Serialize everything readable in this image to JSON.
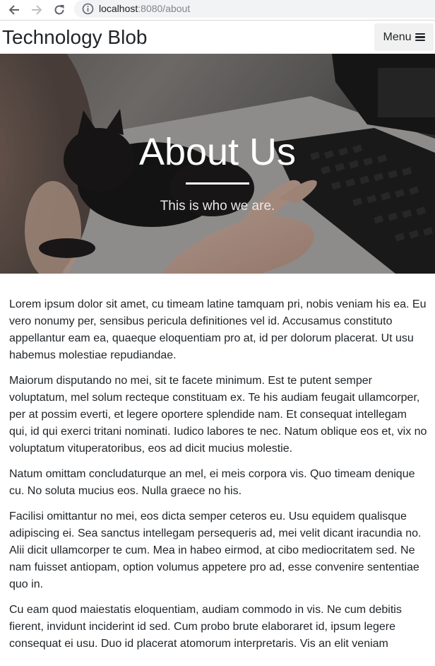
{
  "browser": {
    "url_host": "localhost",
    "url_rest": ":8080/about",
    "icons": [
      "back-arrow-icon",
      "forward-arrow-icon",
      "reload-icon",
      "info-icon"
    ]
  },
  "navbar": {
    "brand": "Technology Blob",
    "menu_label": "Menu",
    "menu_icon": "bars-icon"
  },
  "header": {
    "title": "About Us",
    "subtitle": "This is who we are.",
    "background": "photo of a black cat on a keyboard with a hand"
  },
  "content": {
    "paragraphs": [
      "Lorem ipsum dolor sit amet, cu timeam latine tamquam pri, nobis veniam his ea. Eu vero nonumy per, sensibus pericula definitiones vel id. Accusamus constituto appellantur eam ea, quaeque eloquentiam pro at, id per dolorum placerat. Ut usu habemus molestiae repudiandae.",
      "Maiorum disputando no mei, sit te facete minimum. Est te putent semper voluptatum, mel solum recteque constituam ex. Te his audiam feugait ullamcorper, per at possim everti, et legere oportere splendide nam. Et consequat intellegam qui, id qui exerci tritani nominati. Iudico labores te nec. Natum oblique eos et, vix no voluptatum vituperatoribus, eos ad dicit mucius molestie.",
      "Natum omittam concludaturque an mel, ei meis corpora vis. Quo timeam denique cu. No soluta mucius eos. Nulla graece no his.",
      "Facilisi omittantur no mei, eos dicta semper ceteros eu. Usu equidem qualisque adipiscing ei. Sea sanctus intellegam persequeris ad, mei velit dicant iracundia no. Alii dicit ullamcorper te cum. Mea in habeo eirmod, at cibo mediocritatem sed. Ne nam fuisset antiopam, option volumus appetere pro ad, esse convenire sententiae quo in.",
      "Cu eam quod maiestatis eloquentiam, audiam commodo in vis. Ne cum debitis fierent, invidunt inciderint id sed. Cum probo brute elaboraret id, ipsum legere consequat ei usu. Duo id placerat atomorum interpretaris. Vis an elit veniam"
    ]
  },
  "colors": {
    "text": "#212529",
    "menu_button_bg": "#f1f1f1",
    "address_bar_bg": "#f1f3f4"
  }
}
